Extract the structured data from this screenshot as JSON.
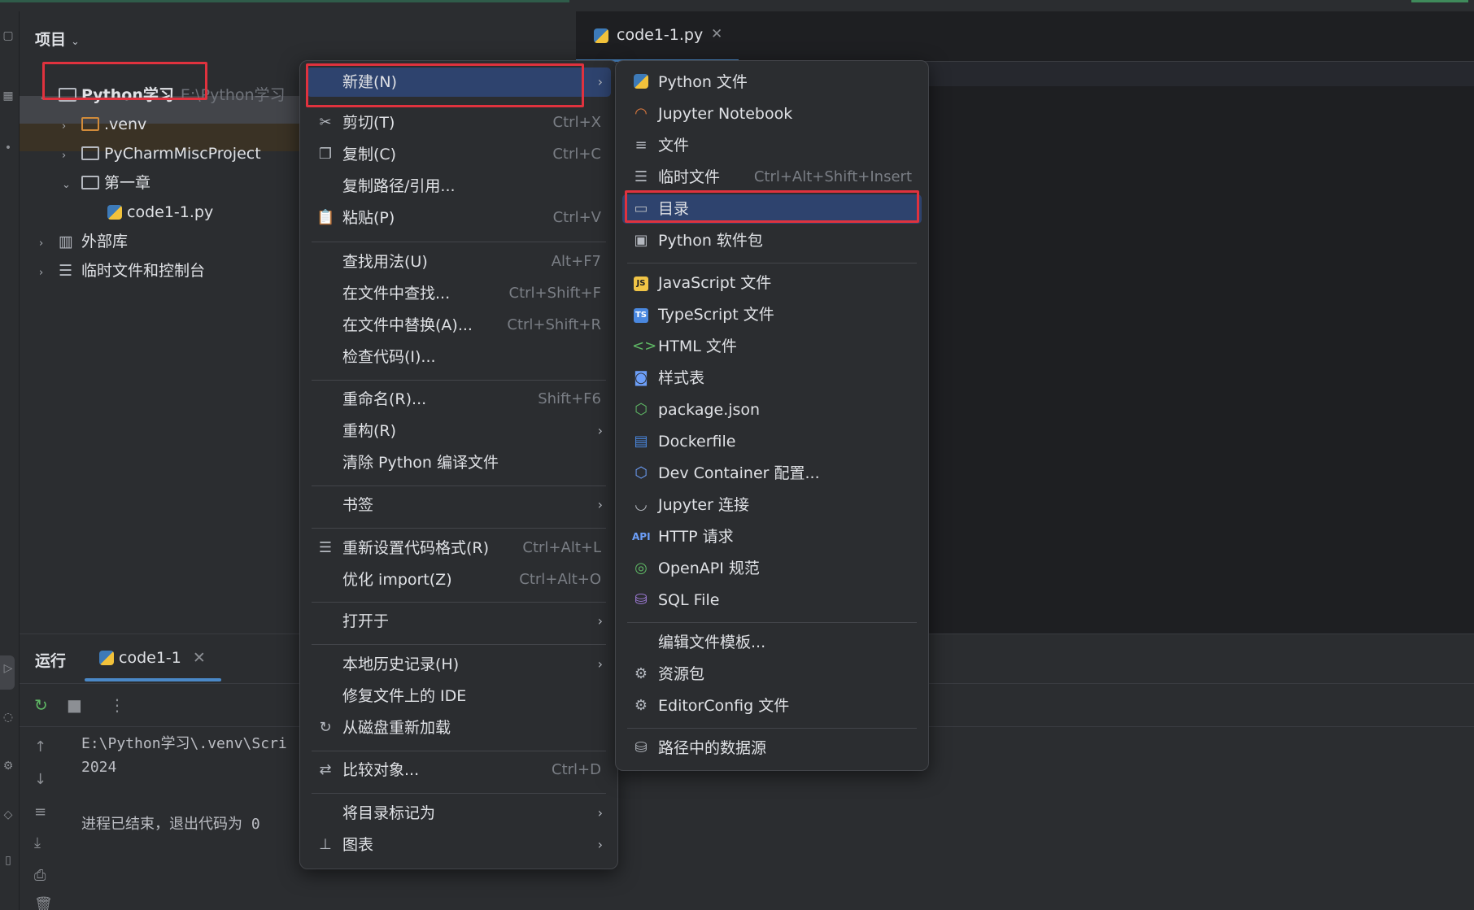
{
  "project": {
    "header": "项目",
    "tree": [
      {
        "label": "Python学习",
        "path": "E:\\Python学习"
      },
      {
        "label": ".venv"
      },
      {
        "label": "PyCharmMiscProject"
      },
      {
        "label": "第一章"
      },
      {
        "label": "code1-1.py"
      },
      {
        "label": "外部库"
      },
      {
        "label": "临时文件和控制台"
      }
    ]
  },
  "editor": {
    "tab_label": "code1-1.py"
  },
  "run": {
    "title": "运行",
    "tab_label": "code1-1",
    "console": [
      "E:\\Python学习\\.venv\\Scri",
      "2024",
      "进程已结束，退出代码为 0"
    ]
  },
  "menu": {
    "items": [
      {
        "label": "新建(N)",
        "shortcut": "",
        "submenu": true
      },
      {
        "label": "剪切(T)",
        "shortcut": "Ctrl+X"
      },
      {
        "label": "复制(C)",
        "shortcut": "Ctrl+C"
      },
      {
        "label": "复制路径/引用...",
        "shortcut": ""
      },
      {
        "label": "粘贴(P)",
        "shortcut": "Ctrl+V"
      },
      {
        "label": "查找用法(U)",
        "shortcut": "Alt+F7"
      },
      {
        "label": "在文件中查找...",
        "shortcut": "Ctrl+Shift+F"
      },
      {
        "label": "在文件中替换(A)...",
        "shortcut": "Ctrl+Shift+R"
      },
      {
        "label": "检查代码(I)...",
        "shortcut": ""
      },
      {
        "label": "重命名(R)...",
        "shortcut": "Shift+F6"
      },
      {
        "label": "重构(R)",
        "shortcut": "",
        "submenu": true
      },
      {
        "label": "清除 Python 编译文件",
        "shortcut": ""
      },
      {
        "label": "书签",
        "shortcut": "",
        "submenu": true
      },
      {
        "label": "重新设置代码格式(R)",
        "shortcut": "Ctrl+Alt+L"
      },
      {
        "label": "优化 import(Z)",
        "shortcut": "Ctrl+Alt+O"
      },
      {
        "label": "打开于",
        "shortcut": "",
        "submenu": true
      },
      {
        "label": "本地历史记录(H)",
        "shortcut": "",
        "submenu": true
      },
      {
        "label": "修复文件上的 IDE",
        "shortcut": ""
      },
      {
        "label": "从磁盘重新加载",
        "shortcut": ""
      },
      {
        "label": "比较对象...",
        "shortcut": "Ctrl+D"
      },
      {
        "label": "将目录标记为",
        "shortcut": "",
        "submenu": true
      },
      {
        "label": "图表",
        "shortcut": "",
        "submenu": true
      }
    ]
  },
  "submenu": {
    "items": [
      {
        "label": "Python 文件",
        "icon": "python-icon"
      },
      {
        "label": "Jupyter Notebook",
        "icon": "jupyter-icon"
      },
      {
        "label": "文件",
        "icon": "file-text-icon"
      },
      {
        "label": "临时文件",
        "shortcut": "Ctrl+Alt+Shift+Insert",
        "icon": "scratch-file-icon"
      },
      {
        "label": "目录",
        "icon": "folder-icon"
      },
      {
        "label": "Python 软件包",
        "icon": "package-icon"
      },
      {
        "label": "JavaScript 文件",
        "icon": "javascript-icon",
        "badge": "JS"
      },
      {
        "label": "TypeScript 文件",
        "icon": "typescript-icon",
        "badge": "TS"
      },
      {
        "label": "HTML 文件",
        "icon": "html-icon"
      },
      {
        "label": "样式表",
        "icon": "css-icon"
      },
      {
        "label": "package.json",
        "icon": "nodejs-icon"
      },
      {
        "label": "Dockerfile",
        "icon": "docker-icon"
      },
      {
        "label": "Dev Container 配置...",
        "icon": "dev-container-icon"
      },
      {
        "label": "Jupyter 连接",
        "icon": "jupyter-connection-icon"
      },
      {
        "label": "HTTP 请求",
        "icon": "api-icon",
        "badge": "API"
      },
      {
        "label": "OpenAPI 规范",
        "icon": "openapi-icon"
      },
      {
        "label": "SQL File",
        "icon": "database-icon"
      },
      {
        "label": "编辑文件模板...",
        "icon": ""
      },
      {
        "label": "资源包",
        "icon": "gear-icon"
      },
      {
        "label": "EditorConfig 文件",
        "icon": "gear-icon"
      },
      {
        "label": "路径中的数据源",
        "icon": "database-icon"
      }
    ]
  },
  "colors": {
    "highlight": "#2e436e",
    "annotation": "#e0323e",
    "accent": "#4a88c7"
  }
}
